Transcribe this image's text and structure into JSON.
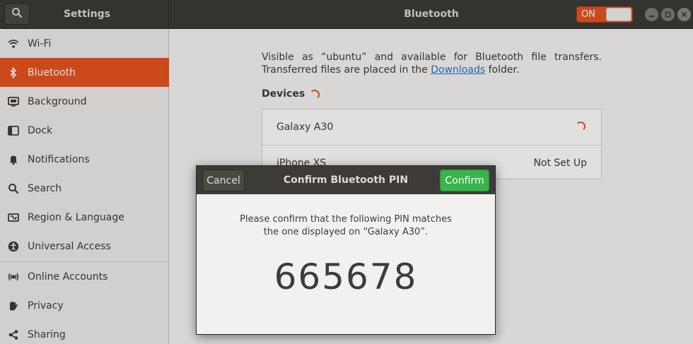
{
  "header": {
    "left_title": "Settings",
    "main_title": "Bluetooth",
    "toggle_label": "ON",
    "toggle_state": true
  },
  "sidebar": {
    "items": [
      {
        "label": "Wi-Fi",
        "icon": "wifi-icon"
      },
      {
        "label": "Bluetooth",
        "icon": "bluetooth-icon",
        "selected": true
      },
      {
        "label": "Background",
        "icon": "background-icon"
      },
      {
        "label": "Dock",
        "icon": "dock-icon"
      },
      {
        "label": "Notifications",
        "icon": "bell-icon"
      },
      {
        "label": "Search",
        "icon": "search-icon"
      },
      {
        "label": "Region & Language",
        "icon": "region-icon"
      },
      {
        "label": "Universal Access",
        "icon": "accessibility-icon"
      },
      {
        "label": "Online Accounts",
        "icon": "online-accounts-icon"
      },
      {
        "label": "Privacy",
        "icon": "hand-icon"
      },
      {
        "label": "Sharing",
        "icon": "share-icon"
      }
    ]
  },
  "main": {
    "description_part1": "Visible as “ubuntu” and available for Bluetooth file transfers. Transferred files are placed in the",
    "downloads_link": "Downloads",
    "description_part2": "folder.",
    "devices_title": "Devices",
    "devices": [
      {
        "name": "Galaxy A30",
        "status": "",
        "busy": true
      },
      {
        "name": "iPhone XS",
        "status": "Not Set Up",
        "busy": false
      }
    ]
  },
  "dialog": {
    "title": "Confirm Bluetooth PIN",
    "cancel_label": "Cancel",
    "confirm_label": "Confirm",
    "message_line1": "Please confirm that the following PIN matches",
    "message_line2": "the one displayed on “Galaxy A30”.",
    "pin": "665678"
  },
  "colors": {
    "accent": "#e95420",
    "confirm": "#38b44a",
    "headerbar": "#3c3b37",
    "link": "#2a76c6"
  }
}
